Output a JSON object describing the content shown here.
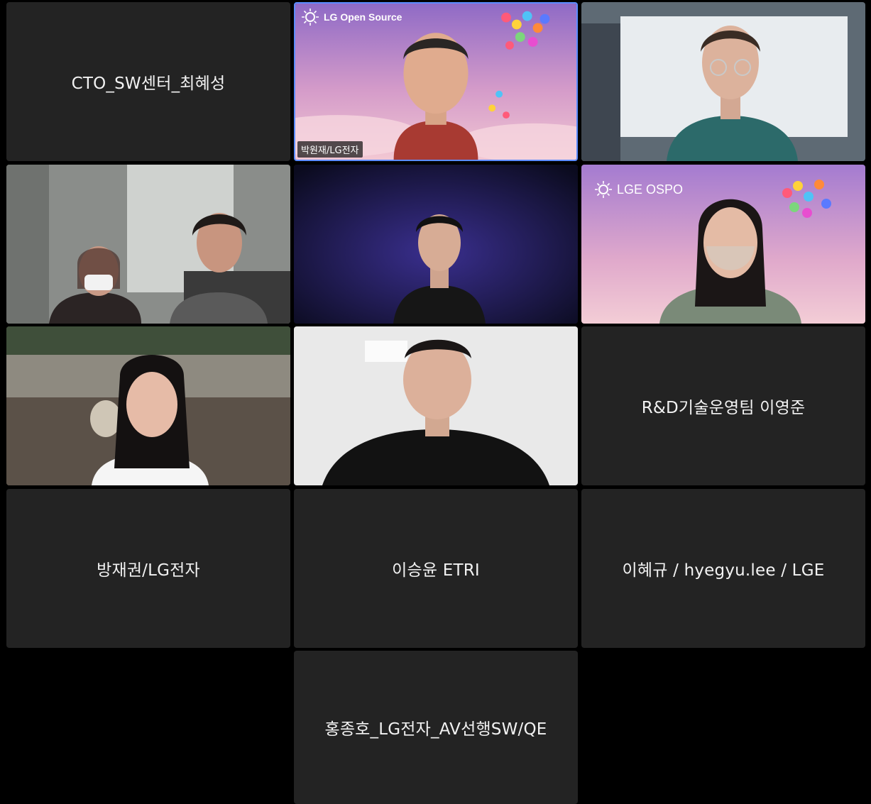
{
  "participants": [
    {
      "name": "CTO_SW센터_최혜성",
      "video": false
    },
    {
      "name": "박원재/LG전자",
      "video": true,
      "active_speaker": true,
      "background_text": "LG Open Source"
    },
    {
      "name": "",
      "video": true
    },
    {
      "name": "",
      "video": true
    },
    {
      "name": "",
      "video": true
    },
    {
      "name": "",
      "video": true,
      "background_text": "LGE OSPO"
    },
    {
      "name": "",
      "video": true
    },
    {
      "name": "",
      "video": true
    },
    {
      "name": "R&D기술운영팀 이영준",
      "video": false
    },
    {
      "name": "방재권/LG전자",
      "video": false
    },
    {
      "name": "이승윤 ETRI",
      "video": false
    },
    {
      "name": "이혜규 / hyegyu.lee / LGE",
      "video": false
    },
    {
      "name": "홍종호_LG전자_AV선행SW/QE",
      "video": false
    }
  ],
  "colors": {
    "tile_bg": "#232323",
    "page_bg": "#000000",
    "active_border": "#5b8cff",
    "name_text": "#f2f2f2"
  }
}
